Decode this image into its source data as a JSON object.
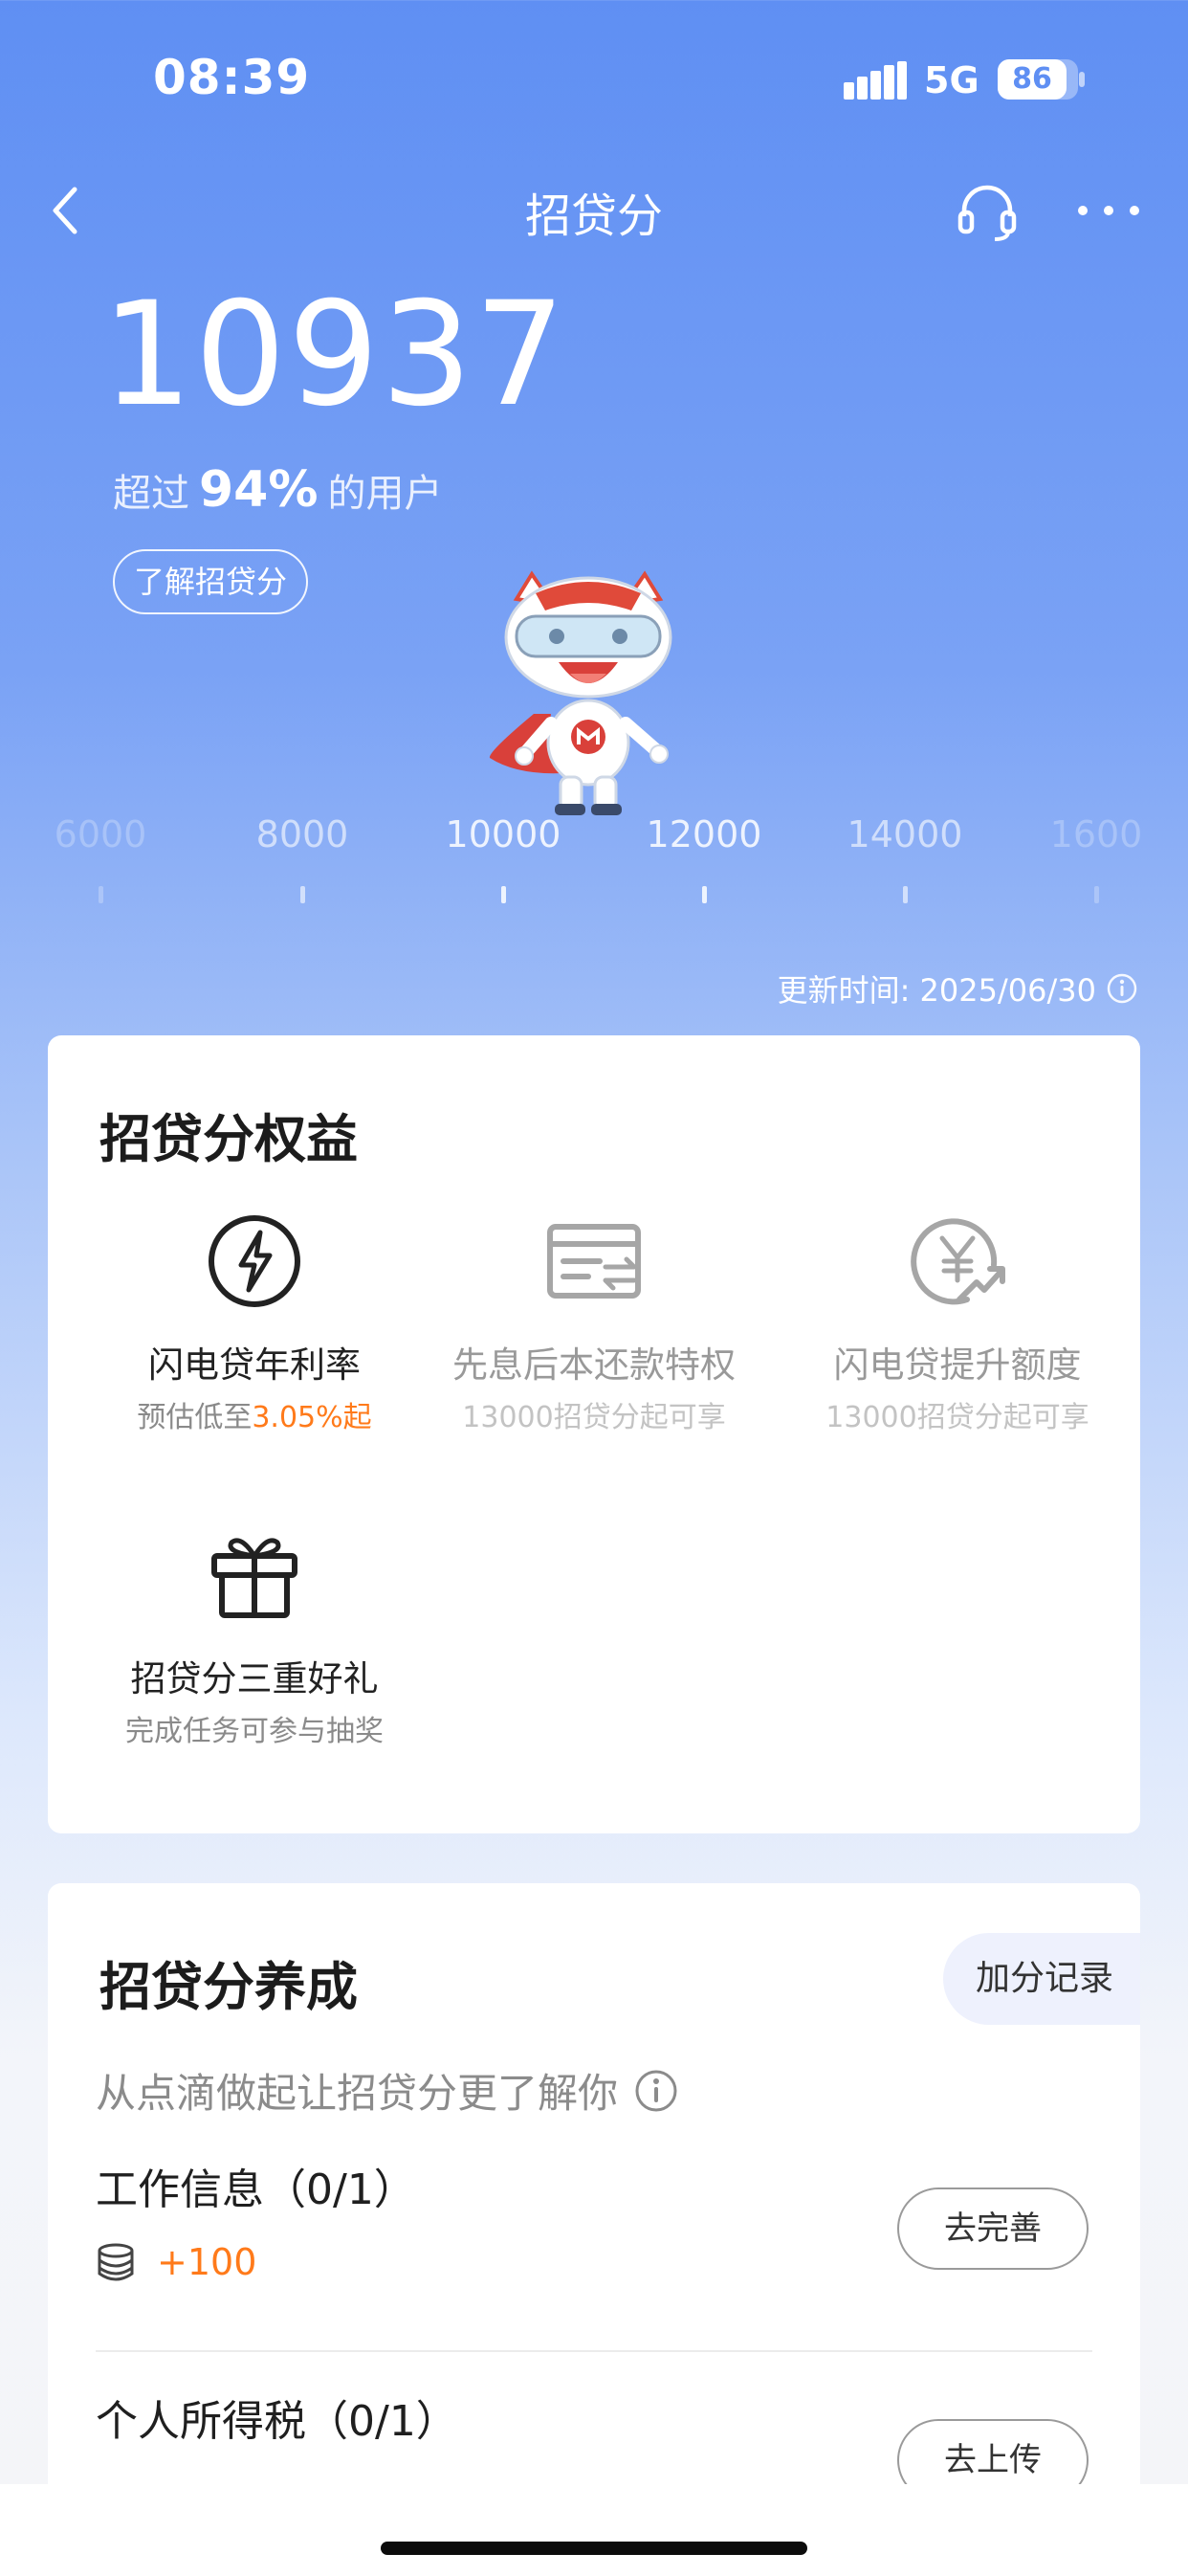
{
  "status_bar": {
    "time": "08:39",
    "network": "5G",
    "battery": "86",
    "battery_level": 0.86
  },
  "nav": {
    "title": "招贷分",
    "back_icon": "chevron-left-icon",
    "service_icon": "headset-icon",
    "more_icon": "more-icon"
  },
  "score": {
    "value": "10937",
    "rank_prefix": "超过",
    "rank_percent": "94%",
    "rank_suffix": "的用户",
    "learn_label": "了解招贷分"
  },
  "ruler": {
    "ticks": [
      "6000",
      "8000",
      "10000",
      "12000",
      "14000",
      "1600"
    ]
  },
  "update_time": "更新时间: 2025/06/30",
  "benefits": {
    "title": "招贷分权益",
    "items": [
      {
        "name": "闪电贷年利率",
        "sub_prefix": "预估低至",
        "sub_highlight": "3.05%起",
        "icon": "lightning-icon",
        "enabled": true
      },
      {
        "name": "先息后本还款特权",
        "sub": "13000招贷分起可享",
        "icon": "repayment-icon",
        "enabled": false
      },
      {
        "name": "闪电贷提升额度",
        "sub": "13000招贷分起可享",
        "icon": "limit-increase-icon",
        "enabled": false
      },
      {
        "name": "招贷分三重好礼",
        "sub": "完成任务可参与抽奖",
        "icon": "gift-icon",
        "enabled": true
      }
    ]
  },
  "growth": {
    "title": "招贷分养成",
    "subtitle": "从点滴做起让招贷分更了解你",
    "log_label": "加分记录",
    "tasks": [
      {
        "title": "工作信息（0/1）",
        "reward": "+100",
        "button": "去完善"
      },
      {
        "title": "个人所得税（0/1）",
        "button": "去上传"
      }
    ]
  },
  "colors": {
    "accent": "#ff7a1a",
    "header_blue": "#5f8ff3",
    "text": "#1c1c1c"
  }
}
